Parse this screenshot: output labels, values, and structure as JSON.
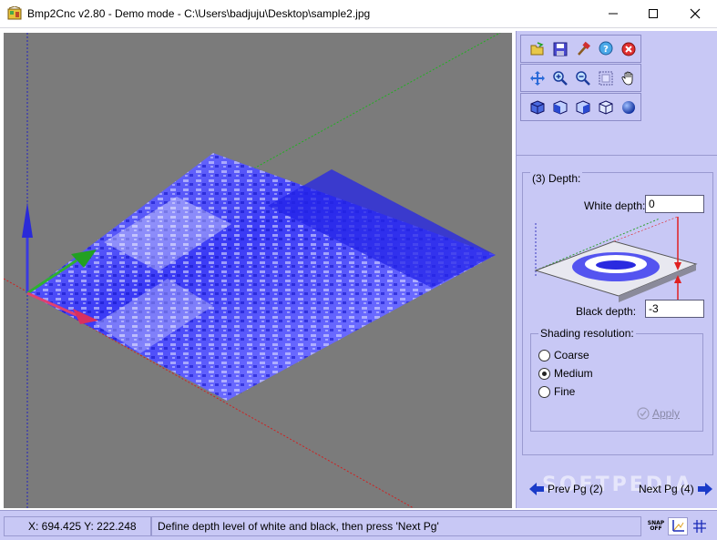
{
  "window": {
    "title": "Bmp2Cnc v2.80 - Demo mode - C:\\Users\\badjuju\\Desktop\\sample2.jpg"
  },
  "toolbar": {
    "row1": [
      "open-icon",
      "save-icon",
      "tools-icon",
      "help-icon",
      "close-red-icon"
    ],
    "row2": [
      "pan-move-icon",
      "zoom-in-icon",
      "zoom-out-icon",
      "zoom-window-icon",
      "hand-icon"
    ],
    "row3": [
      "view-iso-icon",
      "view-front-icon",
      "view-side-icon",
      "view-wire-icon",
      "view-sphere-icon"
    ]
  },
  "depth": {
    "title": "(3) Depth:",
    "white_label": "White depth:",
    "white_value": "0",
    "black_label": "Black depth:",
    "black_value": "-3"
  },
  "shading": {
    "title": "Shading resolution:",
    "options": [
      "Coarse",
      "Medium",
      "Fine"
    ],
    "selected": "Medium",
    "apply_label": "Apply"
  },
  "nav": {
    "prev_label": "Prev Pg (2)",
    "next_label": "Next Pg (4)"
  },
  "watermark": "SOFTPEDIA",
  "status": {
    "coords": "X: 694.425 Y: 222.248",
    "message": "Define depth level of white and black, then press 'Next Pg'",
    "snap_label": [
      "SNAP",
      "OFF"
    ]
  },
  "colors": {
    "panel_bg": "#c8c8f5",
    "viewport_bg": "#7b7b7b",
    "mesh_blue": "#2c2cf0"
  }
}
